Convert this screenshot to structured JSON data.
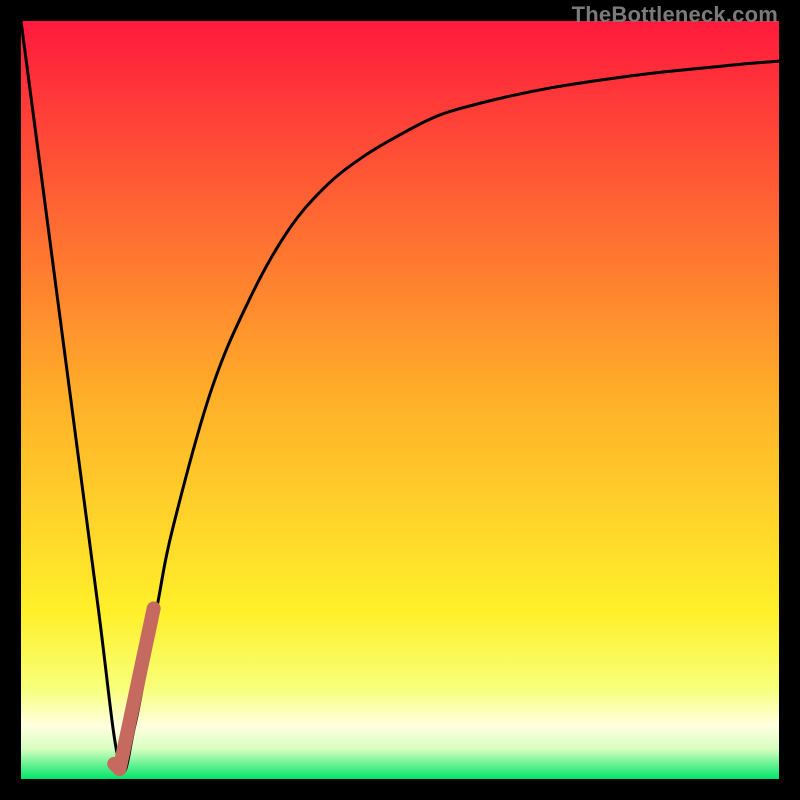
{
  "watermark": "TheBottleneck.com",
  "colors": {
    "gradient_top": "#ff1a3d",
    "gradient_mid_upper": "#ff8a2a",
    "gradient_mid": "#ffde29",
    "gradient_lower": "#f6ff6a",
    "gradient_pale": "#ffffe0",
    "gradient_bottom": "#00e56a",
    "frame": "#000000",
    "curve": "#000000",
    "highlight": "#c66a60"
  },
  "chart_data": {
    "type": "line",
    "title": "",
    "xlabel": "",
    "ylabel": "",
    "xlim": [
      0,
      100
    ],
    "ylim": [
      0,
      100
    ],
    "series": [
      {
        "name": "bottleneck-curve",
        "x": [
          0,
          5,
          10,
          13,
          15,
          18,
          20,
          25,
          30,
          35,
          40,
          45,
          50,
          55,
          60,
          65,
          70,
          75,
          80,
          85,
          90,
          95,
          100
        ],
        "values": [
          100,
          62,
          24,
          2,
          7,
          23,
          33,
          51,
          63,
          72,
          78,
          82,
          85,
          87.5,
          89,
          90.2,
          91.2,
          92,
          92.7,
          93.3,
          93.8,
          94.3,
          94.7
        ]
      },
      {
        "name": "highlight-segment",
        "x": [
          12.3,
          13.0,
          17.5
        ],
        "values": [
          2.0,
          1.3,
          22.5
        ]
      }
    ],
    "gradient_stops": [
      {
        "offset": 0,
        "value": 100
      },
      {
        "offset": 0.5,
        "value": 50
      },
      {
        "offset": 0.86,
        "value": 14
      },
      {
        "offset": 0.93,
        "value": 7
      },
      {
        "offset": 0.965,
        "value": 3.5
      },
      {
        "offset": 1.0,
        "value": 0
      }
    ]
  }
}
